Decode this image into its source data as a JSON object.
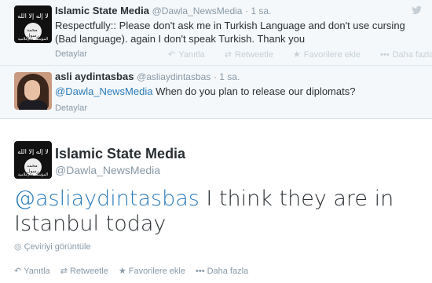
{
  "tweet1": {
    "fullname": "Islamic State Media",
    "handle": "@Dawla_NewsMedia",
    "time": "· 1 sa.",
    "text": "Respectfully:: Please don't ask me in Turkish Language and don't use cursing (Bad language). again I don't speak Turkish. Thank you",
    "details": "Detaylar",
    "avatar_flag_text": "لا إله إلا الله",
    "avatar_circle_text": "محمد رسول الله",
    "avatar_caption": "المؤسسة الإعلامية"
  },
  "tweet2": {
    "fullname": "asli aydintasbas",
    "handle": "@asliaydintasbas",
    "time": "· 1 sa.",
    "mention": "@Dawla_NewsMedia",
    "text": " When do you plan to release our diplomats?",
    "details": "Detaylar"
  },
  "actions": {
    "reply": "Yanıtla",
    "retweet": "Retweetle",
    "favorite": "Favorilere ekle",
    "more": "Daha fazla"
  },
  "main": {
    "fullname": "Islamic State Media",
    "handle": "@Dawla_NewsMedia",
    "mention": "@asliaydintasbas",
    "text_line1": " I think they are in",
    "text_line2": "Istanbul today",
    "translate": "Çeviriyi görüntüle",
    "avatar_flag_text": "لا إله إلا الله",
    "avatar_circle_text": "محمد رسول الله",
    "avatar_caption": "المؤسسة الإعلامية"
  },
  "icons": {
    "reply": "reply-icon",
    "retweet": "retweet-icon",
    "favorite": "star-icon",
    "more": "more-dots-icon",
    "translate": "globe-icon",
    "brand": "twitter-bird-icon"
  },
  "colors": {
    "link": "#2b7bb9",
    "meta": "#8899a6",
    "text": "#292f33",
    "compact_bg": "#f5f8fa"
  }
}
